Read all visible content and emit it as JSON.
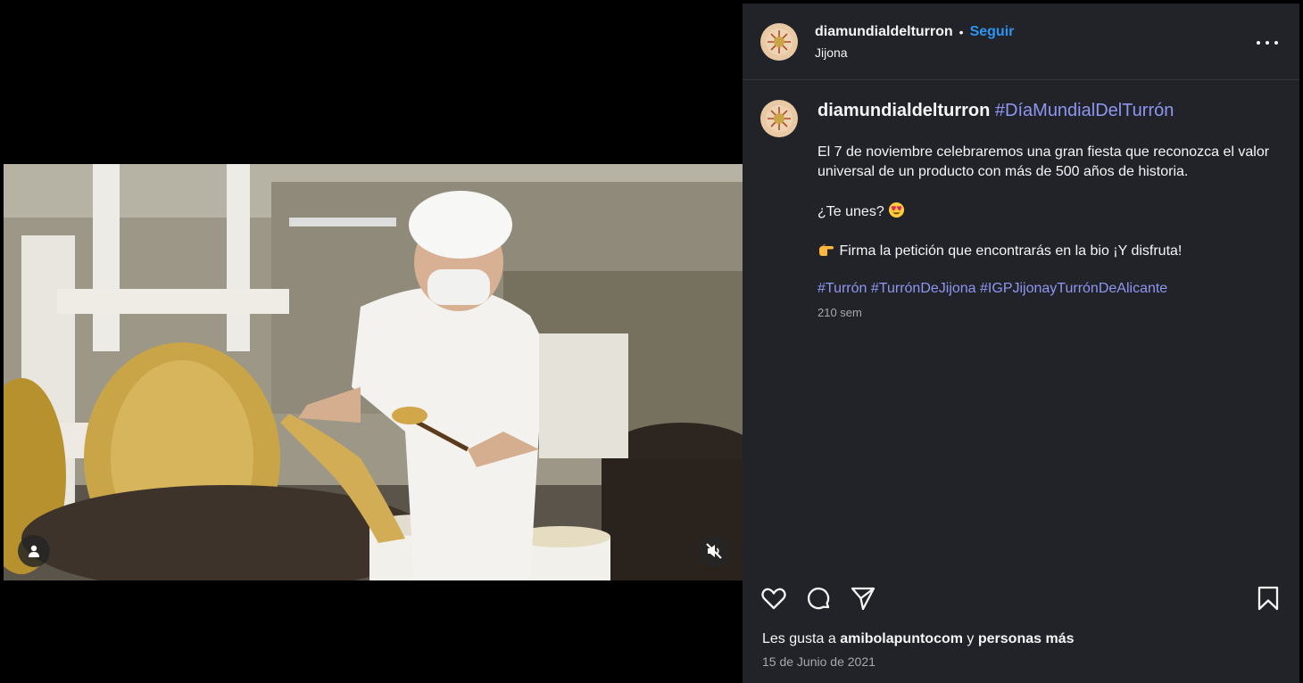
{
  "post": {
    "username": "diamundialdelturron",
    "follow_label": "Seguir",
    "separator": "•",
    "location": "Jijona"
  },
  "caption": {
    "username": "diamundialdelturron",
    "head_hashtag": "#DíaMundialDelTurrón",
    "paragraph1": "El 7 de noviembre celebraremos una gran fiesta que reconozca el valor universal de un producto con más de 500 años de historia.",
    "paragraph2": "¿Te unes?",
    "paragraph3": "Firma la petición que encontrarás en la bio ¡Y disfruta!",
    "hashtags": [
      "#Turrón",
      "#TurrónDeJijona",
      "#IGPJijonayTurrónDeAlicante"
    ],
    "age": "210 sem"
  },
  "likes": {
    "prefix": "Les gusta a",
    "user": "amibolapuntocom",
    "conjunction": "y",
    "suffix": "personas más"
  },
  "date": "15 de Junio de 2021",
  "icons": {
    "like": "heart-icon",
    "comment": "comment-icon",
    "share": "send-icon",
    "save": "bookmark-icon",
    "more": "more-options-icon",
    "user_tag": "user-icon",
    "mute": "muted-speaker-icon",
    "emoji_heart_eyes": "heart-eyes-emoji",
    "emoji_pointing": "pointing-right-emoji"
  },
  "colors": {
    "panel_bg": "#212328",
    "link_blue": "#2b95f6",
    "hashtag": "#8f96f2",
    "muted_text": "#a8a8a8"
  }
}
